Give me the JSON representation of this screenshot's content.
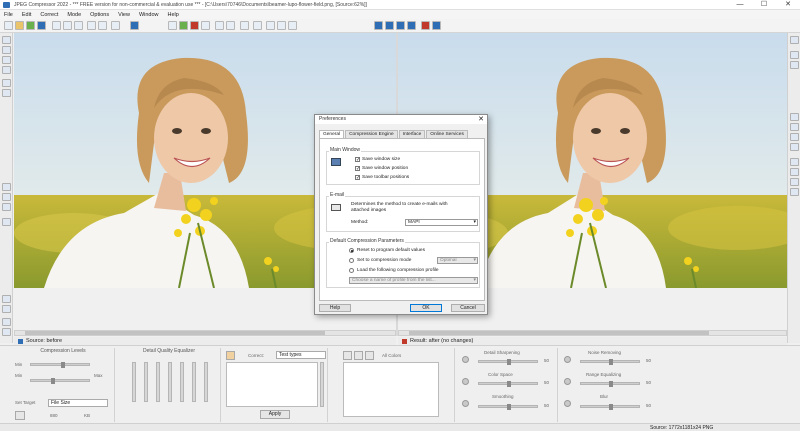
{
  "window": {
    "title": "JPEG Compressor 2022 - *** FREE version for non-commercial & evaluation use *** - [C:\\Users\\70746\\Documents\\beamer-lupo-flower-field.png, [Source:62%]]",
    "controls": [
      "—",
      "☐",
      "✕"
    ]
  },
  "menu": [
    "File",
    "Edit",
    "Correct",
    "Mode",
    "Options",
    "View",
    "Window",
    "Help"
  ],
  "source_pane": {
    "label": "Source: before"
  },
  "result_pane": {
    "label": "Result: after (no changes)"
  },
  "bottom": {
    "compression_levels": "Compression Levels",
    "detail_eq": "Detail Quality Equalizer",
    "correct_label": "Correct:",
    "correct_value": "Test types",
    "set_target": "Set Target",
    "file_size": "File Size",
    "kb": "KB",
    "kb_val": "880",
    "apply": "Apply",
    "ok": "Apply",
    "all_colors": "All Colors",
    "color_space": "Color Space",
    "smoothing": "Smoothing",
    "detail_sharpening": "Detail Sharpening",
    "noise_reduction": "Noise Removing",
    "range_equalizing": "Range Equalizing",
    "artifact_removing": "Artifact Removing",
    "blur": "Blur",
    "min": "Min",
    "max": "Max",
    "vals": [
      "50",
      "50",
      "50",
      "50",
      "50",
      "50"
    ]
  },
  "status": {
    "right": "Source: 1772x1181x24 PNG"
  },
  "dialog": {
    "title": "Preferences",
    "close": "✕",
    "tabs": [
      "General",
      "Compression Engine",
      "Interface",
      "Online Services"
    ],
    "main_window": {
      "title": "Main Window",
      "items": [
        "Save window size",
        "Save window position",
        "Save toolbar positions"
      ]
    },
    "email": {
      "title": "E-mail",
      "desc1": "Determines the method to create e-mails with",
      "desc2": "attached images",
      "method_label": "Method:",
      "method_value": "MAPI"
    },
    "default": {
      "title": "Default Compression Parameters",
      "opt1": "Reset to program default values",
      "opt2": "Set to compression mode",
      "opt2_value": "Optimal",
      "opt3": "Load the following compression profile",
      "profile_placeholder": "Choose a name of profile from the list..."
    },
    "help": "Help",
    "ok": "OK",
    "cancel": "Cancel"
  }
}
